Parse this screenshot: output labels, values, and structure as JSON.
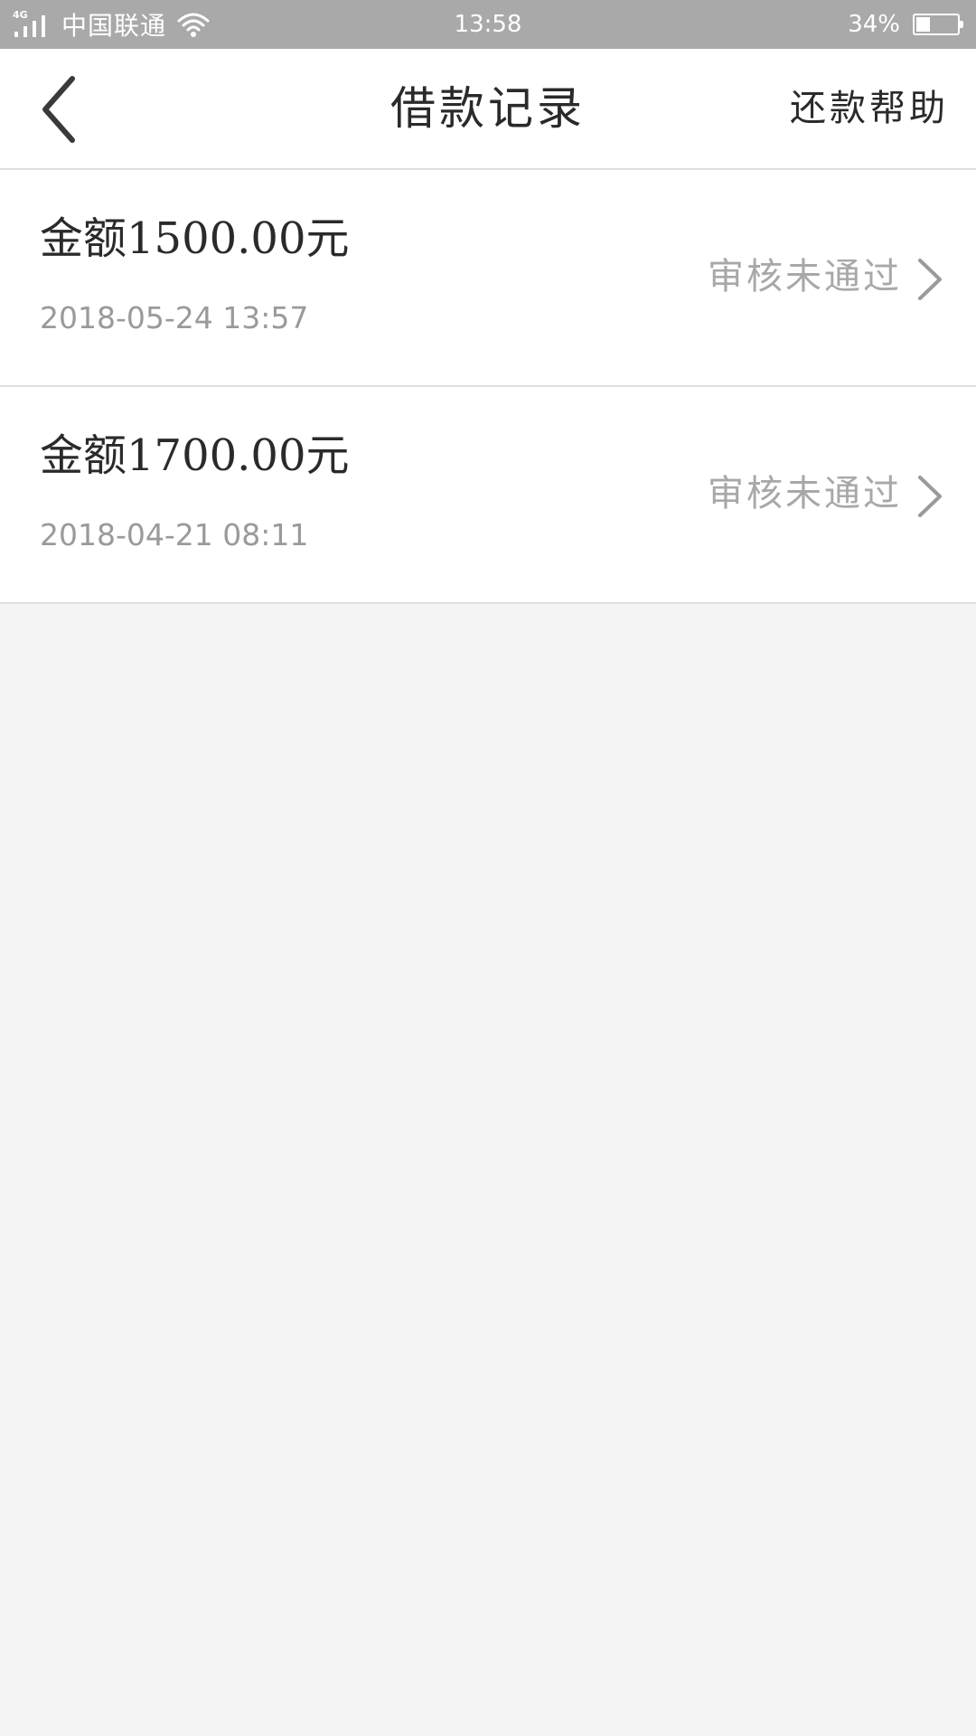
{
  "status_bar": {
    "network": "4G",
    "carrier": "中国联通",
    "time": "13:58",
    "battery_percent": "34%",
    "battery_level": 0.34
  },
  "header": {
    "back_icon": "chevron-left-icon",
    "title": "借款记录",
    "help_label": "还款帮助"
  },
  "records": [
    {
      "amount": "金额1500.00元",
      "datetime": "2018-05-24 13:57",
      "status": "审核未通过"
    },
    {
      "amount": "金额1700.00元",
      "datetime": "2018-04-21 08:11",
      "status": "审核未通过"
    }
  ],
  "colors": {
    "status_bar_bg": "#a9a9a9",
    "page_bg": "#f4f4f4",
    "card_bg": "#ffffff",
    "primary_text": "#2a2a2a",
    "secondary_text": "#9a9a9a",
    "divider": "#dedede"
  }
}
